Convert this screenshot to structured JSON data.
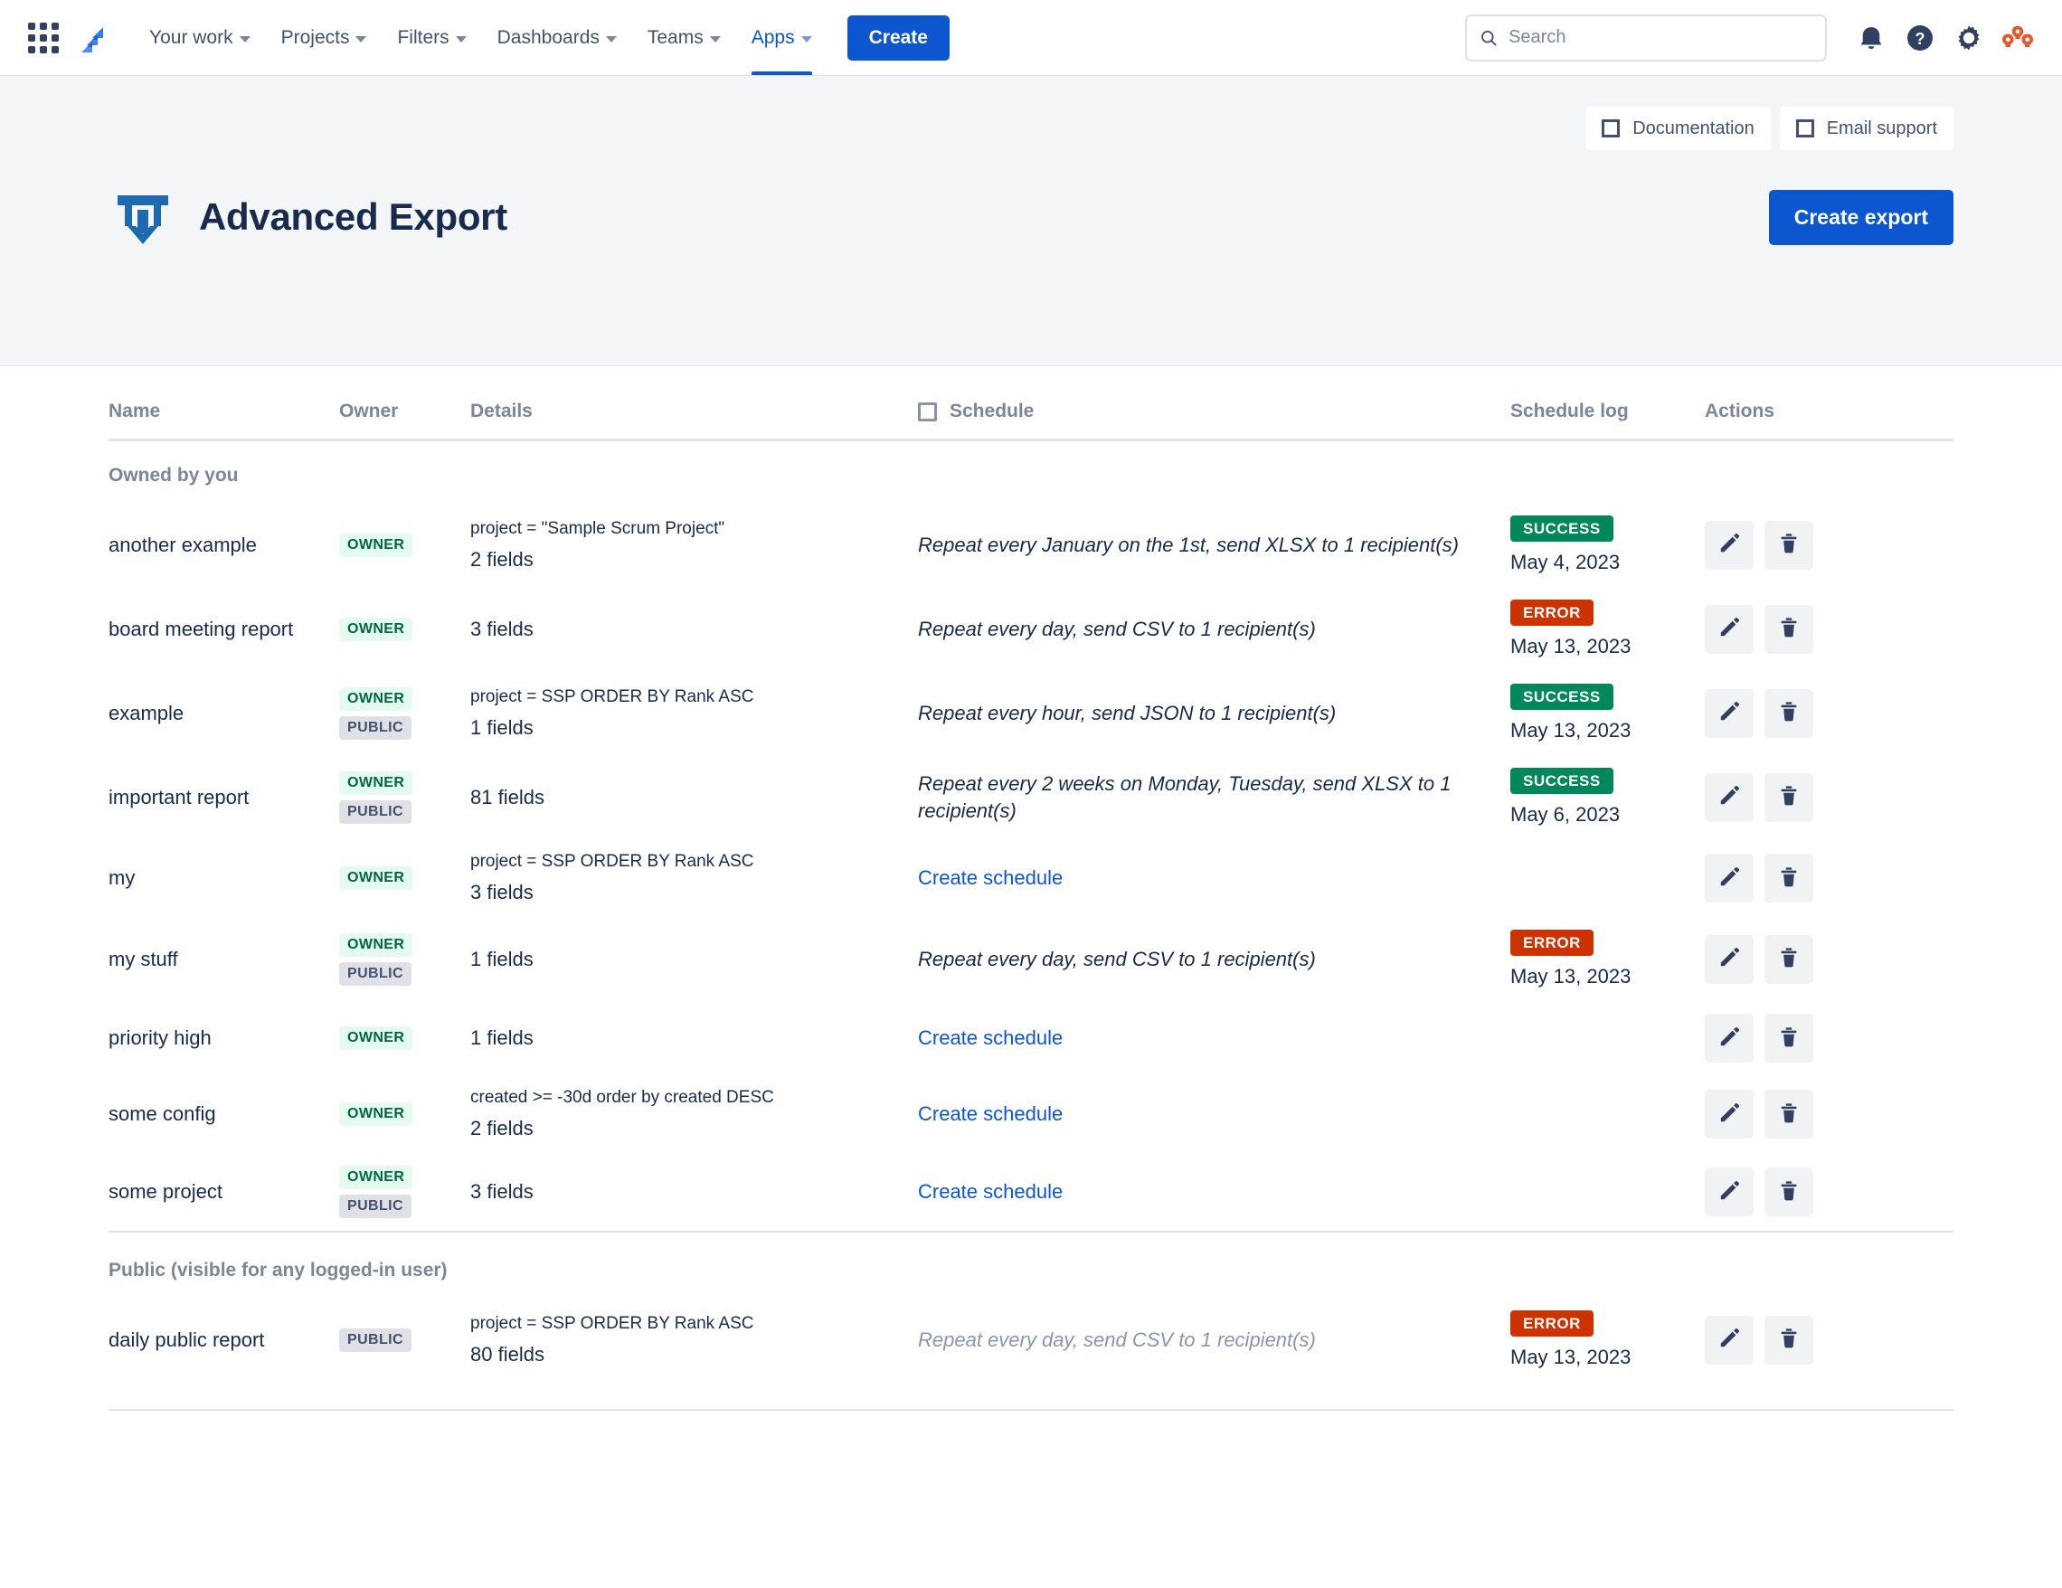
{
  "nav": {
    "items": [
      {
        "label": "Your work",
        "has_caret": true,
        "active": false
      },
      {
        "label": "Projects",
        "has_caret": true,
        "active": false
      },
      {
        "label": "Filters",
        "has_caret": true,
        "active": false
      },
      {
        "label": "Dashboards",
        "has_caret": true,
        "active": false
      },
      {
        "label": "Teams",
        "has_caret": true,
        "active": false
      },
      {
        "label": "Apps",
        "has_caret": true,
        "active": true
      }
    ],
    "create_label": "Create",
    "search_placeholder": "Search",
    "search_value": "",
    "icons": [
      "app-switcher-icon",
      "jira-logo-icon",
      "search-icon",
      "notifications-icon",
      "help-icon",
      "settings-icon",
      "avatar-icon"
    ],
    "accent_color": "#0c56d0"
  },
  "header": {
    "documentation_label": "Documentation",
    "email_support_label": "Email support",
    "title": "Advanced Export",
    "create_export_label": "Create export",
    "logo_color": "#1c6bb0",
    "band_color": "#f4f5f7"
  },
  "table": {
    "columns": {
      "name": "Name",
      "owner": "Owner",
      "details": "Details",
      "schedule": "Schedule",
      "schedule_log": "Schedule log",
      "actions": "Actions"
    },
    "groups": [
      {
        "label": "Owned by you",
        "rows": [
          {
            "name": "another example",
            "badges": [
              "OWNER"
            ],
            "query": "project = \"Sample Scrum Project\"",
            "fields": "2 fields",
            "schedule": "Repeat every January on the 1st, send XLSX to 1 recipient(s)",
            "schedule_is_link": false,
            "schedule_muted": false,
            "status": "SUCCESS",
            "status_kind": "success",
            "date": "May 4, 2023"
          },
          {
            "name": "board meeting report",
            "badges": [
              "OWNER"
            ],
            "query": "",
            "fields": "3 fields",
            "schedule": "Repeat every day, send CSV to 1 recipient(s)",
            "schedule_is_link": false,
            "schedule_muted": false,
            "status": "ERROR",
            "status_kind": "error",
            "date": "May 13, 2023"
          },
          {
            "name": "example",
            "badges": [
              "OWNER",
              "PUBLIC"
            ],
            "query": "project = SSP ORDER BY Rank ASC",
            "fields": "1 fields",
            "schedule": "Repeat every hour, send JSON to 1 recipient(s)",
            "schedule_is_link": false,
            "schedule_muted": false,
            "status": "SUCCESS",
            "status_kind": "success",
            "date": "May 13, 2023"
          },
          {
            "name": "important report",
            "badges": [
              "OWNER",
              "PUBLIC"
            ],
            "query": "",
            "fields": "81 fields",
            "schedule": "Repeat every 2 weeks on Monday, Tuesday, send XLSX to 1 recipient(s)",
            "schedule_is_link": false,
            "schedule_muted": false,
            "status": "SUCCESS",
            "status_kind": "success",
            "date": "May 6, 2023"
          },
          {
            "name": "my",
            "badges": [
              "OWNER"
            ],
            "query": "project = SSP ORDER BY Rank ASC",
            "fields": "3 fields",
            "schedule": "Create schedule",
            "schedule_is_link": true,
            "schedule_muted": false,
            "status": "",
            "status_kind": "",
            "date": ""
          },
          {
            "name": "my stuff",
            "badges": [
              "OWNER",
              "PUBLIC"
            ],
            "query": "",
            "fields": "1 fields",
            "schedule": "Repeat every day, send CSV to 1 recipient(s)",
            "schedule_is_link": false,
            "schedule_muted": false,
            "status": "ERROR",
            "status_kind": "error",
            "date": "May 13, 2023"
          },
          {
            "name": "priority high",
            "badges": [
              "OWNER"
            ],
            "query": "",
            "fields": "1 fields",
            "schedule": "Create schedule",
            "schedule_is_link": true,
            "schedule_muted": false,
            "status": "",
            "status_kind": "",
            "date": ""
          },
          {
            "name": "some config",
            "badges": [
              "OWNER"
            ],
            "query": "created >= -30d order by created DESC",
            "fields": "2 fields",
            "schedule": "Create schedule",
            "schedule_is_link": true,
            "schedule_muted": false,
            "status": "",
            "status_kind": "",
            "date": ""
          },
          {
            "name": "some project",
            "badges": [
              "OWNER",
              "PUBLIC"
            ],
            "query": "",
            "fields": "3 fields",
            "schedule": "Create schedule",
            "schedule_is_link": true,
            "schedule_muted": false,
            "status": "",
            "status_kind": "",
            "date": ""
          }
        ]
      },
      {
        "label": "Public (visible for any logged-in user)",
        "rows": [
          {
            "name": "daily public report",
            "badges": [
              "PUBLIC"
            ],
            "query": "project = SSP ORDER BY Rank ASC",
            "fields": "80 fields",
            "schedule": "Repeat every day, send CSV to 1 recipient(s)",
            "schedule_is_link": false,
            "schedule_muted": true,
            "status": "ERROR",
            "status_kind": "error",
            "date": "May 13, 2023"
          }
        ]
      }
    ],
    "row_actions": {
      "edit": "edit-icon",
      "delete": "delete-icon"
    },
    "status_colors": {
      "success": "#00875a",
      "error": "#cc3300"
    }
  }
}
